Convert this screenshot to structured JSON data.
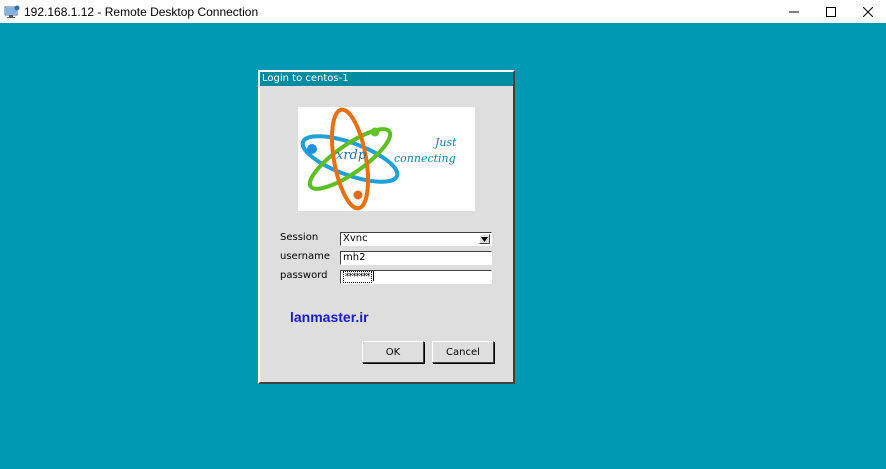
{
  "window": {
    "title": "192.168.1.12 - Remote Desktop Connection",
    "app_icon": "remote-desktop-icon",
    "controls": [
      "minimize-icon",
      "maximize-icon",
      "close-icon"
    ]
  },
  "desktop_color": "#0099b4",
  "dialog": {
    "title": "Login to centos-1",
    "logo": {
      "wordmark": "xrdp",
      "tagline_line1": "Just",
      "tagline_line2": "connecting"
    },
    "fields": {
      "session_label": "Session",
      "session_value": "Xvnc",
      "username_label": "username",
      "username_value": "mh2",
      "password_label": "password",
      "password_value": "*******"
    },
    "brand_text": "lanmaster.ir",
    "buttons": {
      "ok_label": "OK",
      "cancel_label": "Cancel"
    }
  },
  "colors": {
    "title_bar_accent": "#008ca0",
    "brand_text": "#1a1ad0",
    "dialog_bg": "#dedede"
  }
}
